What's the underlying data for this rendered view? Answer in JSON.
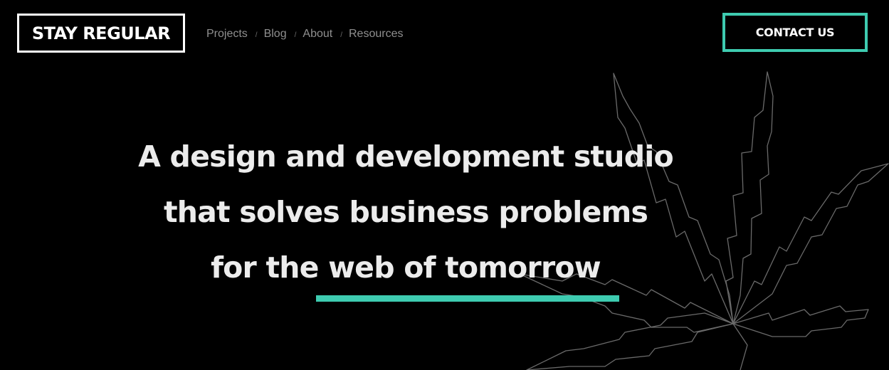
{
  "header": {
    "logo_text": "STAY REGULAR",
    "nav": [
      {
        "label": "Projects"
      },
      {
        "label": "Blog"
      },
      {
        "label": "About"
      },
      {
        "label": "Resources"
      }
    ],
    "separator": "/",
    "cta_label": "CONTACT US"
  },
  "hero": {
    "lines": [
      "A design and development studio",
      "that solves business problems",
      "for the web of tomorrow"
    ],
    "background_icon": "cannabis-leaf-outline"
  },
  "colors": {
    "background": "#000000",
    "accent": "#3ecbb0",
    "text": "#ffffff",
    "nav_text": "#8f8f8f"
  }
}
